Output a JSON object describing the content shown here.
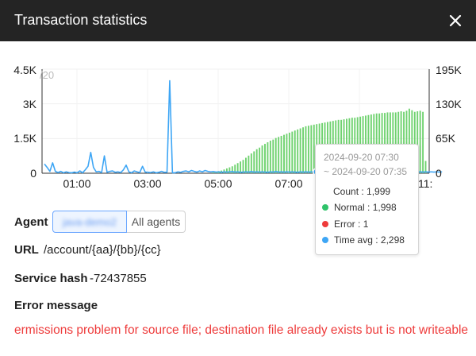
{
  "header": {
    "title": "Transaction statistics"
  },
  "chart_data": {
    "type": "bar",
    "x_tick_labels": [
      "01:00",
      "03:00",
      "05:00",
      "07:00",
      "11:"
    ],
    "y_left_ticks": [
      "4.5K",
      "3K",
      "1.5K",
      "0"
    ],
    "y_left_extra": "/20",
    "y_right_ticks": [
      "195K",
      "130K",
      "65K",
      "0"
    ],
    "ylim_left": [
      0,
      4500
    ],
    "ylim_right": [
      0,
      195000
    ],
    "series": [
      {
        "name": "Count",
        "kind": "bar",
        "axis": "right",
        "color": "#6fd26f",
        "values": [
          0,
          0,
          0,
          0,
          0,
          0,
          0,
          0,
          0,
          0,
          0,
          0,
          0,
          0,
          0,
          0,
          0,
          0,
          0,
          0,
          0,
          0,
          0,
          0,
          0,
          0,
          0,
          0,
          0,
          0,
          0,
          0,
          0,
          0,
          0,
          0,
          0,
          0,
          0,
          0,
          0,
          0,
          0,
          0,
          0,
          0,
          0,
          0,
          0,
          0,
          0,
          0,
          0,
          0,
          0,
          0,
          0,
          0,
          0,
          0,
          0,
          0,
          2000,
          3000,
          4000,
          5000,
          7000,
          9000,
          11000,
          13000,
          16000,
          19000,
          22000,
          25000,
          29000,
          33000,
          37000,
          41000,
          45000,
          48000,
          52000,
          55000,
          58000,
          61000,
          63000,
          66000,
          68000,
          70000,
          72000,
          74000,
          76000,
          78000,
          80000,
          82000,
          84000,
          86000,
          88000,
          89000,
          90000,
          91000,
          92000,
          93000,
          94000,
          95000,
          96000,
          97000,
          98000,
          99000,
          100000,
          100000,
          101000,
          102000,
          103000,
          104000,
          104000,
          105000,
          106000,
          107000,
          108000,
          109000,
          110000,
          111000,
          112000,
          112000,
          113000,
          113000,
          114000,
          114000,
          114000,
          114000,
          115000,
          116000,
          115000,
          117000,
          121000,
          118000,
          115000,
          116000,
          117000,
          115000,
          23000
        ]
      },
      {
        "name": "Time avg",
        "kind": "line",
        "axis": "left",
        "color": "#3ea6f5",
        "values": [
          400,
          250,
          80,
          450,
          80,
          30,
          80,
          20,
          60,
          30,
          20,
          50,
          20,
          100,
          20,
          150,
          300,
          900,
          250,
          60,
          80,
          30,
          750,
          40,
          80,
          100,
          40,
          60,
          30,
          150,
          350,
          60,
          20,
          100,
          60,
          30,
          300,
          50,
          40,
          30,
          60,
          20,
          40,
          80,
          40,
          40,
          4000,
          20,
          20,
          60,
          40,
          80,
          100,
          60,
          120,
          80,
          50,
          100,
          60,
          120,
          80,
          60,
          70,
          50,
          60,
          40,
          60,
          50,
          60,
          70,
          50,
          60,
          40,
          50,
          60,
          50,
          70,
          50,
          60,
          50,
          60,
          50,
          40,
          60,
          50,
          70,
          50,
          60,
          50,
          60,
          50,
          60,
          50,
          40,
          60,
          50,
          60,
          50,
          60,
          50,
          60,
          50,
          60,
          40,
          60,
          50,
          60,
          50,
          60,
          50,
          60,
          50,
          60,
          50,
          60,
          50,
          60,
          50,
          60,
          50,
          60,
          50,
          60,
          50,
          60,
          50,
          60,
          50,
          60,
          50,
          60,
          50,
          60,
          50,
          60,
          50,
          60,
          50,
          60,
          50,
          60,
          50,
          60,
          50,
          60,
          50,
          60
        ]
      }
    ],
    "highlight_index": 100,
    "grid": true,
    "legend": "none"
  },
  "tooltip": {
    "time_start": "2024-09-20 07:30",
    "time_end": "~ 2024-09-20 07:35",
    "rows": [
      {
        "label": "Count",
        "value": "1,999",
        "color": ""
      },
      {
        "label": "Normal",
        "value": "1,998",
        "color": "#2fc36a"
      },
      {
        "label": "Error",
        "value": "1",
        "color": "#ee3b3b"
      },
      {
        "label": "Time avg",
        "value": "2,298",
        "color": "#3ea6f5"
      }
    ]
  },
  "agent": {
    "label": "Agent",
    "selected": "java-demo2",
    "all": "All agents"
  },
  "url": {
    "label": "URL",
    "value": "/account/{aa}/{bb}/{cc}"
  },
  "service_hash": {
    "label": "Service hash",
    "value": "-72437855"
  },
  "error": {
    "label": "Error message",
    "message": "ermissions problem for source file; destination file already exists but is not writeable"
  }
}
